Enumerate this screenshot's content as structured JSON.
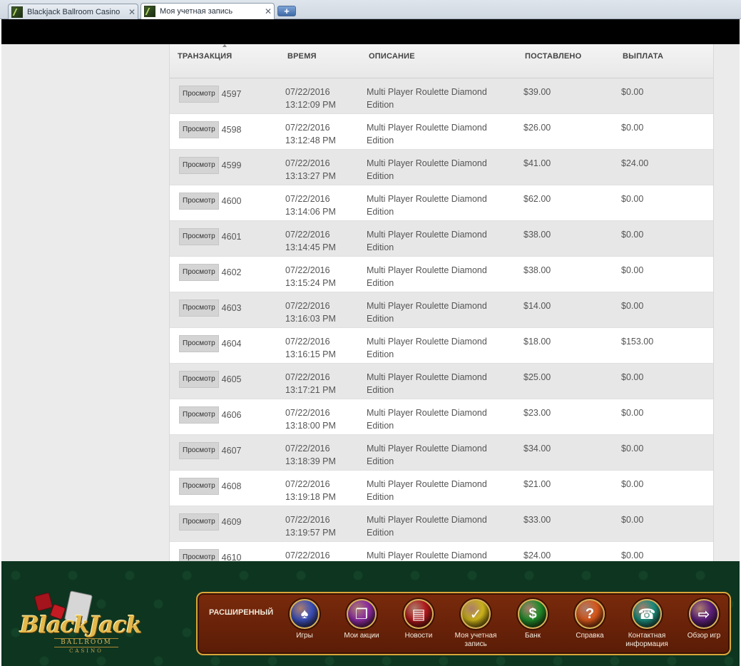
{
  "browser": {
    "tabs": [
      {
        "label": "Blackjack Ballroom Casino",
        "active": false
      },
      {
        "label": "Моя учетная запись",
        "active": true
      }
    ]
  },
  "table": {
    "headers": {
      "transaction": "ТРАНЗАКЦИЯ",
      "time": "ВРЕМЯ",
      "description": "ОПИСАНИЕ",
      "bet": "ПОСТАВЛЕНО",
      "payout": "ВЫПЛАТА"
    },
    "view_label": "Просмотр",
    "rows": [
      {
        "id": "4597",
        "date": "07/22/2016",
        "time": "13:12:09 PM",
        "desc1": "Multi Player Roulette Diamond",
        "desc2": "Edition",
        "bet": "$39.00",
        "payout": "$0.00"
      },
      {
        "id": "4598",
        "date": "07/22/2016",
        "time": "13:12:48 PM",
        "desc1": "Multi Player Roulette Diamond",
        "desc2": "Edition",
        "bet": "$26.00",
        "payout": "$0.00"
      },
      {
        "id": "4599",
        "date": "07/22/2016",
        "time": "13:13:27 PM",
        "desc1": "Multi Player Roulette Diamond",
        "desc2": "Edition",
        "bet": "$41.00",
        "payout": "$24.00"
      },
      {
        "id": "4600",
        "date": "07/22/2016",
        "time": "13:14:06 PM",
        "desc1": "Multi Player Roulette Diamond",
        "desc2": "Edition",
        "bet": "$62.00",
        "payout": "$0.00"
      },
      {
        "id": "4601",
        "date": "07/22/2016",
        "time": "13:14:45 PM",
        "desc1": "Multi Player Roulette Diamond",
        "desc2": "Edition",
        "bet": "$38.00",
        "payout": "$0.00"
      },
      {
        "id": "4602",
        "date": "07/22/2016",
        "time": "13:15:24 PM",
        "desc1": "Multi Player Roulette Diamond",
        "desc2": "Edition",
        "bet": "$38.00",
        "payout": "$0.00"
      },
      {
        "id": "4603",
        "date": "07/22/2016",
        "time": "13:16:03 PM",
        "desc1": "Multi Player Roulette Diamond",
        "desc2": "Edition",
        "bet": "$14.00",
        "payout": "$0.00"
      },
      {
        "id": "4604",
        "date": "07/22/2016",
        "time": "13:16:15 PM",
        "desc1": "Multi Player Roulette Diamond",
        "desc2": "Edition",
        "bet": "$18.00",
        "payout": "$153.00"
      },
      {
        "id": "4605",
        "date": "07/22/2016",
        "time": "13:17:21 PM",
        "desc1": "Multi Player Roulette Diamond",
        "desc2": "Edition",
        "bet": "$25.00",
        "payout": "$0.00"
      },
      {
        "id": "4606",
        "date": "07/22/2016",
        "time": "13:18:00 PM",
        "desc1": "Multi Player Roulette Diamond",
        "desc2": "Edition",
        "bet": "$23.00",
        "payout": "$0.00"
      },
      {
        "id": "4607",
        "date": "07/22/2016",
        "time": "13:18:39 PM",
        "desc1": "Multi Player Roulette Diamond",
        "desc2": "Edition",
        "bet": "$34.00",
        "payout": "$0.00"
      },
      {
        "id": "4608",
        "date": "07/22/2016",
        "time": "13:19:18 PM",
        "desc1": "Multi Player Roulette Diamond",
        "desc2": "Edition",
        "bet": "$21.00",
        "payout": "$0.00"
      },
      {
        "id": "4609",
        "date": "07/22/2016",
        "time": "13:19:57 PM",
        "desc1": "Multi Player Roulette Diamond",
        "desc2": "Edition",
        "bet": "$33.00",
        "payout": "$0.00"
      },
      {
        "id": "4610",
        "date": "07/22/2016",
        "time": "",
        "desc1": "Multi Player Roulette Diamond",
        "desc2": "",
        "bet": "$24.00",
        "payout": "$0.00"
      }
    ]
  },
  "footer": {
    "logo": {
      "main": "BlackJack",
      "sub": "BALLROOM",
      "sub2": "CASINO"
    },
    "nav_title": "РАСШИРЕННЫЙ",
    "nav": [
      {
        "label": "Игры",
        "icon": "games-icon",
        "color": "#3a4fb8"
      },
      {
        "label": "Мои акции",
        "icon": "gift-icon",
        "color": "#8a2aa0"
      },
      {
        "label": "Новости",
        "icon": "news-icon",
        "color": "#b0181c"
      },
      {
        "label": "Моя учетная запись",
        "icon": "thumbs-up-icon",
        "color": "#c9b21a"
      },
      {
        "label": "Банк",
        "icon": "dollar-icon",
        "color": "#1f8a2a"
      },
      {
        "label": "Справка",
        "icon": "help-icon",
        "color": "#d4561a"
      },
      {
        "label": "Контактная информация",
        "icon": "phone-icon",
        "color": "#1a8a7a"
      },
      {
        "label": "Обзор игр",
        "icon": "game-overview-icon",
        "color": "#5a1f7a"
      }
    ]
  }
}
